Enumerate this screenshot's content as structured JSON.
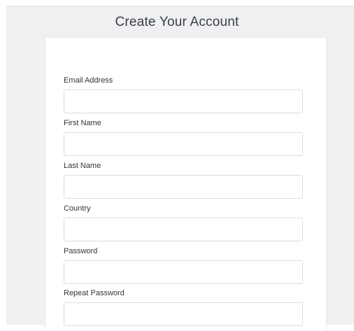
{
  "page": {
    "title": "Create Your Account"
  },
  "form": {
    "fields": [
      {
        "label": "Email Address",
        "value": "",
        "placeholder": ""
      },
      {
        "label": "First Name",
        "value": "",
        "placeholder": ""
      },
      {
        "label": "Last Name",
        "value": "",
        "placeholder": ""
      },
      {
        "label": "Country",
        "value": "",
        "placeholder": ""
      },
      {
        "label": "Password",
        "value": "",
        "placeholder": ""
      },
      {
        "label": "Repeat Password",
        "value": "",
        "placeholder": ""
      }
    ]
  },
  "colors": {
    "page_background": "#eff0f2",
    "card_background": "#ffffff",
    "input_border": "#d9dde2",
    "text": "#2f3338"
  }
}
